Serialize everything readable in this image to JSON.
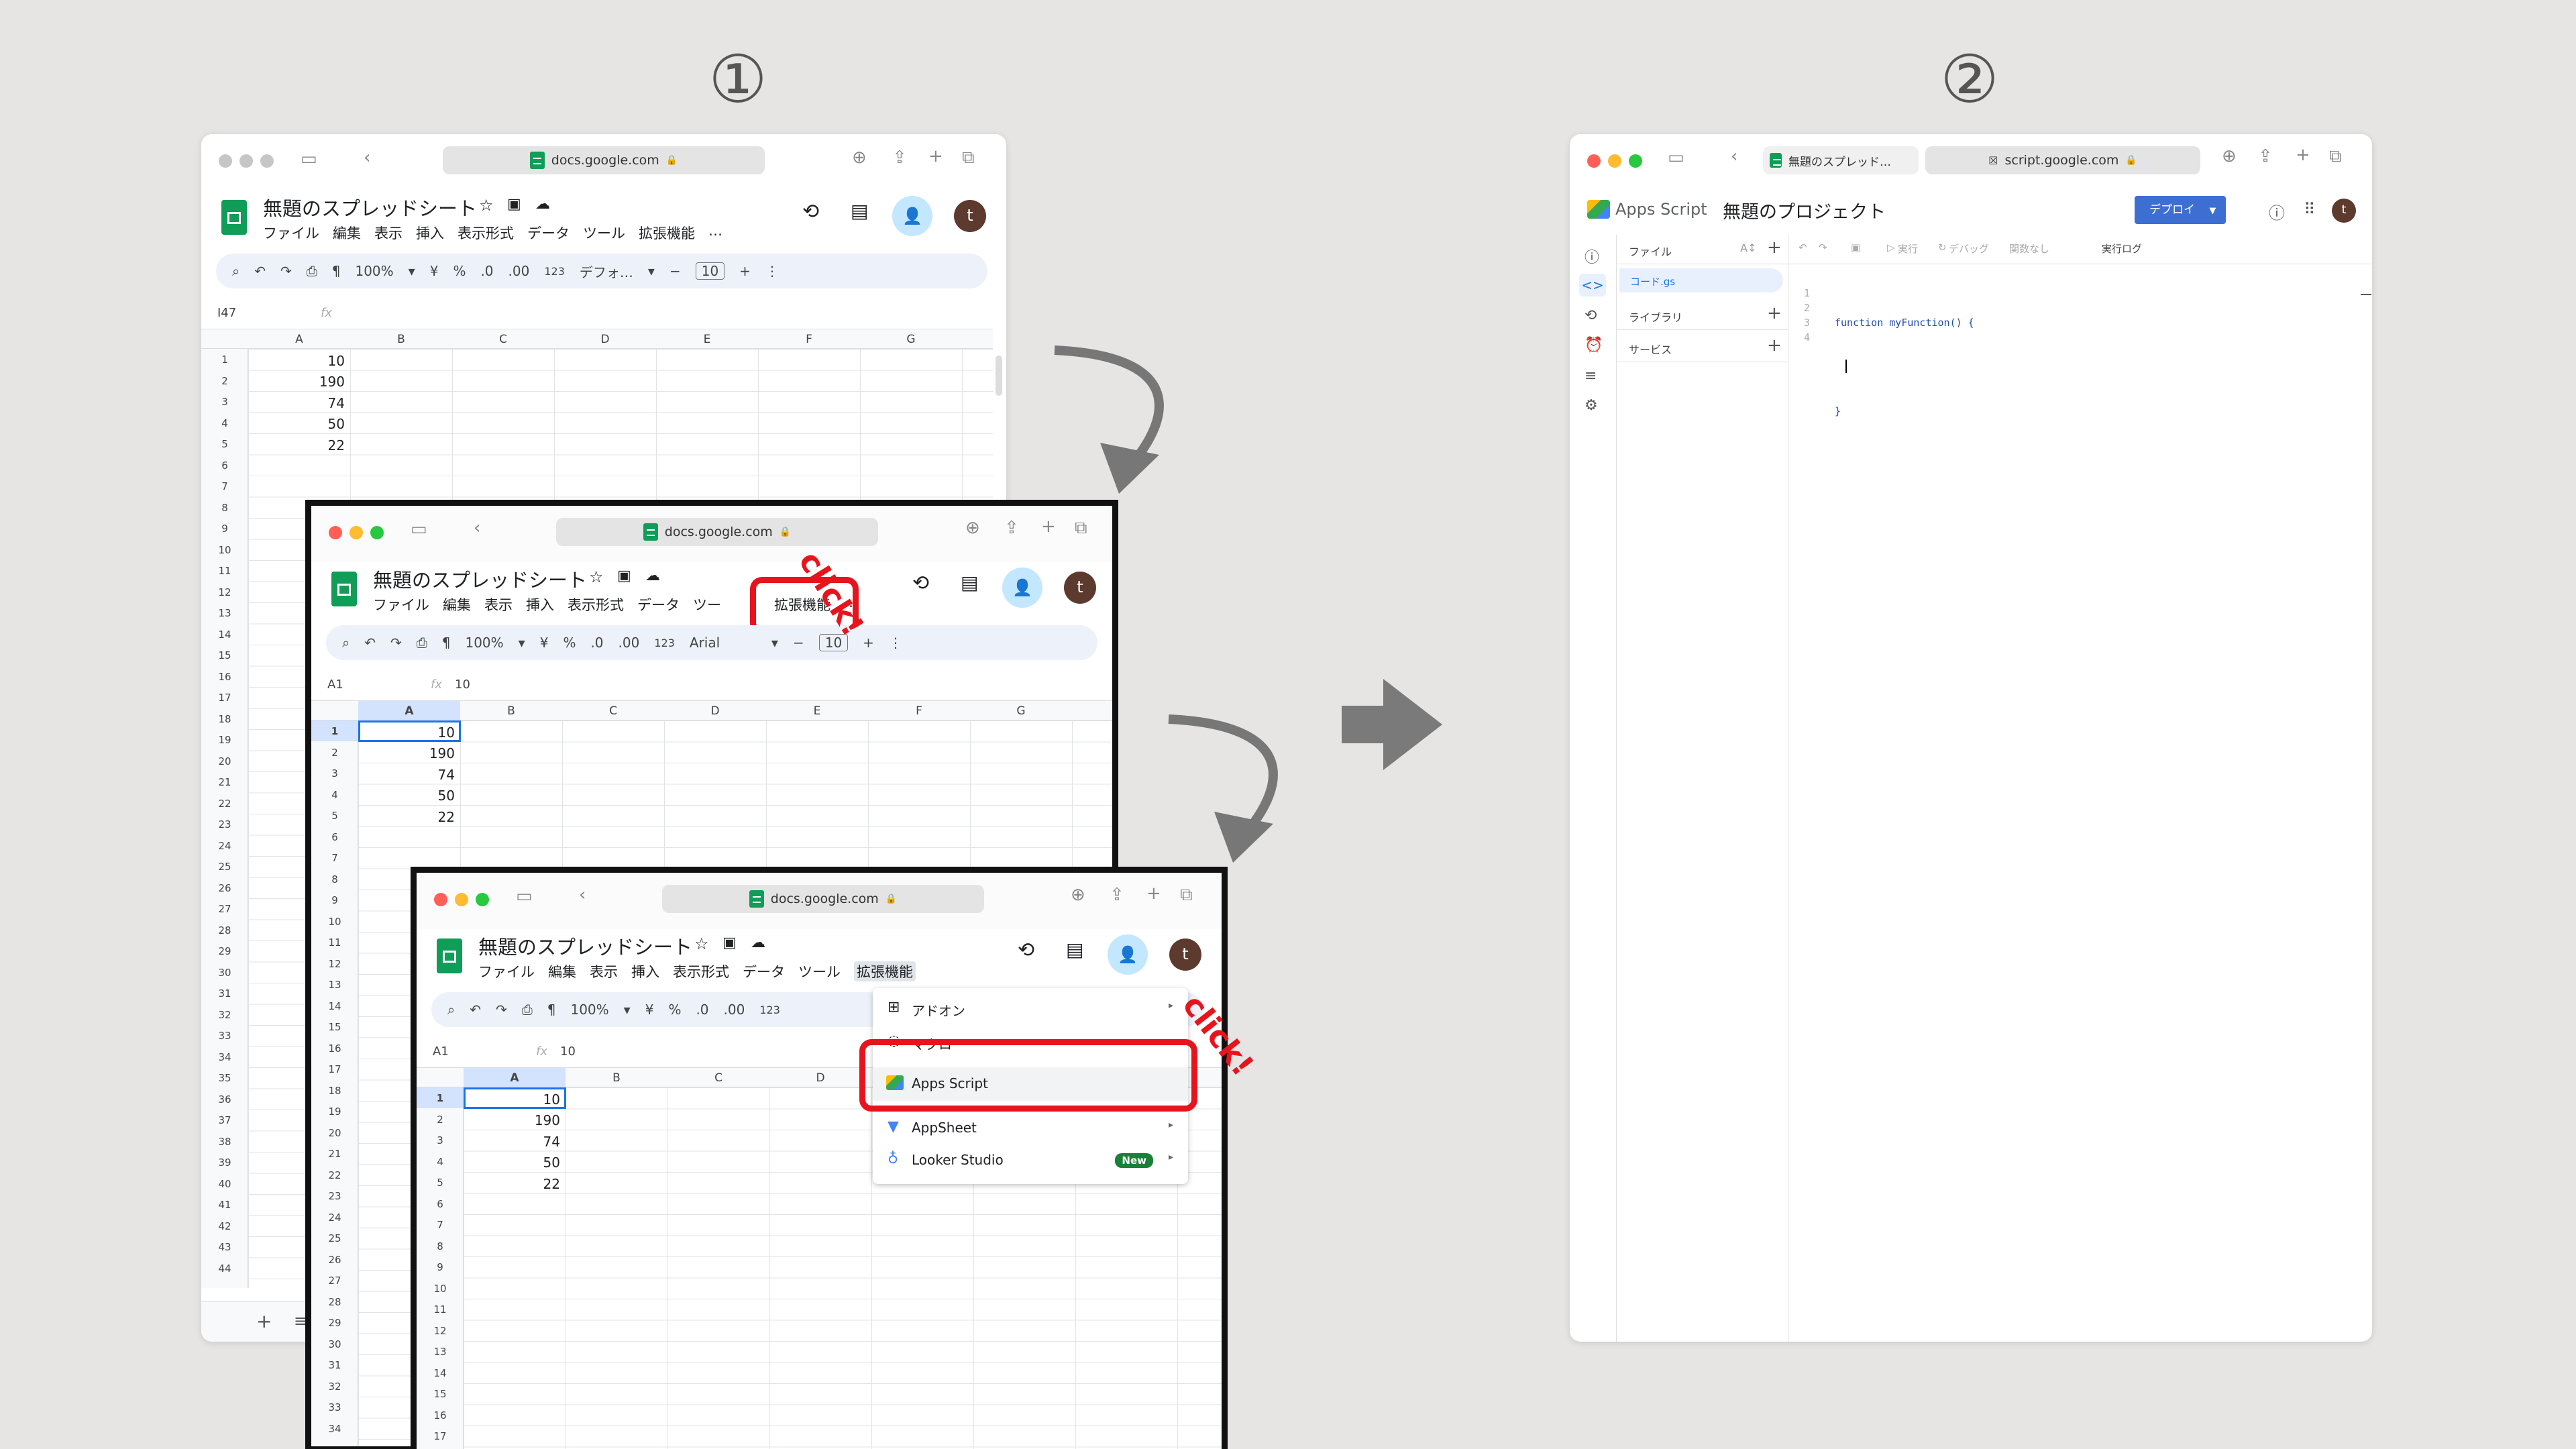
{
  "steps": {
    "one": "①",
    "two": "②"
  },
  "browser": {
    "sheets_url": "docs.google.com",
    "script_url": "script.google.com",
    "script_tab_title": "無題のスプレッド…"
  },
  "sheet": {
    "title": "無題のスプレッドシート",
    "menus": [
      "ファイル",
      "編集",
      "表示",
      "挿入",
      "表示形式",
      "データ",
      "ツール",
      "拡張機能"
    ],
    "menus_short": [
      "ファイル",
      "編集",
      "表示",
      "挿入",
      "表示形式",
      "データ",
      "ツー"
    ],
    "ext_menu": "拡張機能",
    "more": "…",
    "zoom": "100%",
    "currency": "¥",
    "percent": "%",
    "dec_less": ".0",
    "dec_more": ".00",
    "num_fmt": "123",
    "font_default": "デフォ…",
    "font_arial": "Arial",
    "font_size": "10",
    "namebox_back": "I47",
    "namebox_front": "A1",
    "fx_label": "fx",
    "fx_value": "10",
    "columns": [
      "A",
      "B",
      "C",
      "D",
      "E",
      "F",
      "G"
    ],
    "values": [
      "10",
      "190",
      "74",
      "50",
      "22"
    ],
    "avatar": "t",
    "add_sheet": "+"
  },
  "rows_back": [
    "1",
    "2",
    "3",
    "4",
    "5",
    "6",
    "7",
    "8",
    "9",
    "10",
    "11",
    "12",
    "13",
    "14",
    "15",
    "16",
    "17",
    "18",
    "19",
    "20",
    "21",
    "22",
    "23",
    "24",
    "25",
    "26",
    "27",
    "28",
    "29",
    "30",
    "31",
    "32",
    "33",
    "34",
    "35",
    "36",
    "37",
    "38",
    "39",
    "40",
    "41",
    "42",
    "43",
    "44"
  ],
  "rows_mid": [
    "1",
    "2",
    "3",
    "4",
    "5",
    "6",
    "7",
    "8",
    "9",
    "10",
    "11",
    "12",
    "13",
    "14",
    "15",
    "16",
    "17",
    "18",
    "19",
    "20",
    "21",
    "22",
    "23",
    "24",
    "25",
    "26",
    "27",
    "28",
    "29",
    "30",
    "31",
    "32",
    "33",
    "34"
  ],
  "rows_front": [
    "1",
    "2",
    "3",
    "4",
    "5",
    "6",
    "7",
    "8",
    "9",
    "10",
    "11",
    "12",
    "13",
    "14",
    "15",
    "16",
    "17"
  ],
  "click_label": "click!",
  "dropdown": {
    "addons": "アドオン",
    "macro": "マクロ",
    "apps_script": "Apps Script",
    "appsheet": "AppSheet",
    "looker": "Looker Studio",
    "new_badge": "New"
  },
  "apps_script": {
    "brand": "Apps Script",
    "project": "無題のプロジェクト",
    "deploy": "デプロイ",
    "files_label": "ファイル",
    "file_name": "コード.gs",
    "library_label": "ライブラリ",
    "service_label": "サービス",
    "run": "実行",
    "debug": "デバッグ",
    "no_func": "関数なし",
    "exec_log": "実行ログ",
    "line_numbers": [
      "1",
      "2",
      "3",
      "4"
    ],
    "code_lines": [
      "function myFunction() {",
      "",
      "}",
      ""
    ],
    "avatar": "t"
  }
}
